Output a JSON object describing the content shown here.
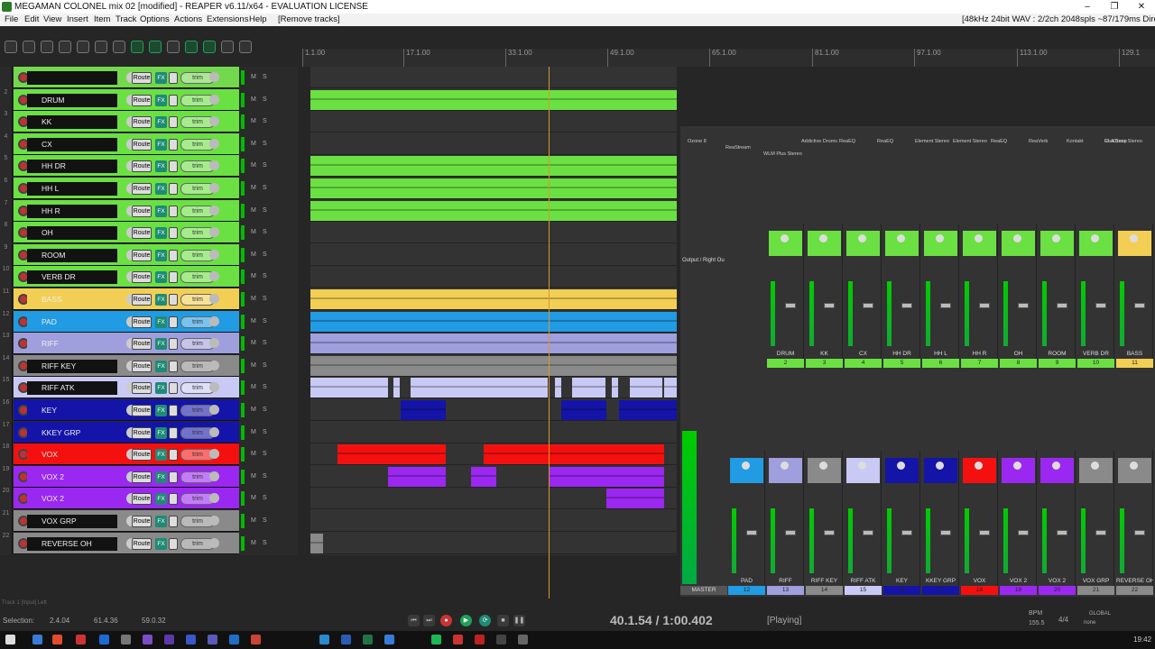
{
  "window": {
    "title": "MEGAMAN COLONEL mix 02 [modified] - REAPER v6.11/x64 - EVALUATION LICENSE",
    "minimize": "–",
    "maximize": "❐",
    "close": "✕"
  },
  "menu": {
    "items": [
      "File",
      "Edit",
      "View",
      "Insert",
      "Item",
      "Track",
      "Options",
      "Actions",
      "Extensions",
      "Help",
      "[Remove tracks]"
    ],
    "status": "[48kHz 24bit WAV : 2/2ch 2048spls ~87/179ms DirectSour"
  },
  "ruler": {
    "markers": [
      "1.1.00",
      "17.1.00",
      "33.1.00",
      "49.1.00",
      "65.1.00",
      "81.1.00",
      "97.1.00",
      "113.1.00",
      "129.1"
    ]
  },
  "track_buttons": {
    "route": "Route",
    "fx": "FX",
    "trim": "trim",
    "m": "M",
    "s": "S"
  },
  "tracks": [
    {
      "num": "",
      "name": "",
      "color": "#74d84e",
      "nameColor": "#121212"
    },
    {
      "num": "2",
      "name": "DRUM",
      "color": "#6be042",
      "nameColor": "#121212"
    },
    {
      "num": "3",
      "name": "KK",
      "color": "#6be042",
      "nameColor": "#121212"
    },
    {
      "num": "4",
      "name": "CX",
      "color": "#6be042",
      "nameColor": "#121212"
    },
    {
      "num": "5",
      "name": "HH DR",
      "color": "#6be042",
      "nameColor": "#121212"
    },
    {
      "num": "6",
      "name": "HH L",
      "color": "#6be042",
      "nameColor": "#121212"
    },
    {
      "num": "7",
      "name": "HH R",
      "color": "#6be042",
      "nameColor": "#121212"
    },
    {
      "num": "8",
      "name": "OH",
      "color": "#6be042",
      "nameColor": "#121212"
    },
    {
      "num": "9",
      "name": "ROOM",
      "color": "#6be042",
      "nameColor": "#121212"
    },
    {
      "num": "10",
      "name": "VERB DR",
      "color": "#6be042",
      "nameColor": "#121212"
    },
    {
      "num": "11",
      "name": "BASS",
      "color": "#f2cf54",
      "nameColor": "#f2cf54"
    },
    {
      "num": "12",
      "name": "PAD",
      "color": "#219be3",
      "nameColor": "#219be3"
    },
    {
      "num": "13",
      "name": "RIFF",
      "color": "#9f9fdd",
      "nameColor": "#9f9fdd"
    },
    {
      "num": "14",
      "name": "RIFF KEY",
      "color": "#8a8a8a",
      "nameColor": "#121212"
    },
    {
      "num": "15",
      "name": "RIFF ATK",
      "color": "#c9c9f5",
      "nameColor": "#121212"
    },
    {
      "num": "16",
      "name": "KEY",
      "color": "#1414a8",
      "nameColor": "#1414a8"
    },
    {
      "num": "17",
      "name": "KKEY GRP",
      "color": "#1414a8",
      "nameColor": "#1414a8"
    },
    {
      "num": "18",
      "name": "VOX",
      "color": "#f51010",
      "nameColor": "#f51010"
    },
    {
      "num": "19",
      "name": "VOX 2",
      "color": "#9a28f0",
      "nameColor": "#9a28f0"
    },
    {
      "num": "20",
      "name": "VOX 2",
      "color": "#9a28f0",
      "nameColor": "#9a28f0"
    },
    {
      "num": "21",
      "name": "VOX GRP",
      "color": "#8a8a8a",
      "nameColor": "#121212"
    },
    {
      "num": "22",
      "name": "REVERSE OH",
      "color": "#8a8a8a",
      "nameColor": "#121212"
    }
  ],
  "mixer": {
    "fx_top": [
      "Ozone 8",
      "ReaStream",
      "WLM Plus Stereo",
      "Addictive Drums",
      "ReaEQ",
      "ReaEQ",
      "Element Stereo",
      "Element Stereo",
      "ReaEQ",
      "ReaVerb",
      "Kontakt",
      "ReaComp",
      "CLA Bass Stereo"
    ],
    "output_label": "Output / Right Ou",
    "strips_top": [
      {
        "name": "DRUM",
        "num": "2",
        "color": "#6be042"
      },
      {
        "name": "KK",
        "num": "3",
        "color": "#6be042"
      },
      {
        "name": "CX",
        "num": "4",
        "color": "#6be042"
      },
      {
        "name": "HH DR",
        "num": "5",
        "color": "#6be042"
      },
      {
        "name": "HH L",
        "num": "6",
        "color": "#6be042"
      },
      {
        "name": "HH R",
        "num": "7",
        "color": "#6be042"
      },
      {
        "name": "OH",
        "num": "8",
        "color": "#6be042"
      },
      {
        "name": "ROOM",
        "num": "9",
        "color": "#6be042"
      },
      {
        "name": "VERB DR",
        "num": "10",
        "color": "#6be042"
      },
      {
        "name": "BASS",
        "num": "11",
        "color": "#f2cf54"
      }
    ],
    "strips_bottom": [
      {
        "name": "PAD",
        "num": "12",
        "color": "#219be3"
      },
      {
        "name": "RIFF",
        "num": "13",
        "color": "#9f9fdd"
      },
      {
        "name": "RIFF KEY",
        "num": "14",
        "color": "#8a8a8a"
      },
      {
        "name": "RIFF ATK",
        "num": "15",
        "color": "#c9c9f5"
      },
      {
        "name": "KEY",
        "num": "16",
        "color": "#1414a8"
      },
      {
        "name": "KKEY GRP",
        "num": "17",
        "color": "#1414a8"
      },
      {
        "name": "VOX",
        "num": "18",
        "color": "#f51010"
      },
      {
        "name": "VOX 2",
        "num": "19",
        "color": "#9a28f0"
      },
      {
        "name": "VOX 2",
        "num": "20",
        "color": "#9a28f0"
      },
      {
        "name": "VOX GRP",
        "num": "21",
        "color": "#8a8a8a"
      },
      {
        "name": "REVERSE OH",
        "num": "22",
        "color": "#8a8a8a"
      }
    ],
    "master_label": "MASTER"
  },
  "transport": {
    "selection_label": "Selection:",
    "sel_start": "2.4.04",
    "sel_end": "61.4.36",
    "sel_len": "59.0.32",
    "position": "40.1.54 / 1:00.402",
    "state": "[Playing]",
    "bpm_label": "BPM",
    "bpm": "155.5",
    "timesig": "4/4",
    "global_label": "GLOBAL",
    "none_label": "none",
    "status_hint": "Track 1 [Input] Left"
  },
  "taskbar": {
    "clock": "19:42"
  }
}
